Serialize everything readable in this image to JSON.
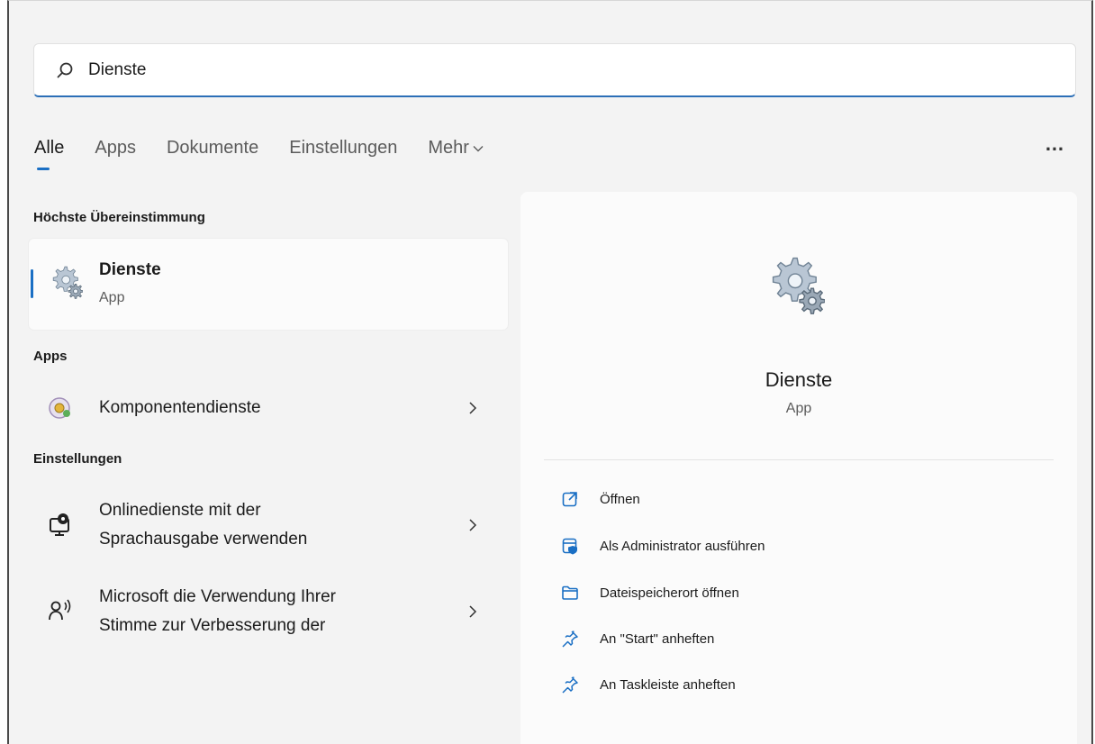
{
  "search": {
    "value": "Dienste"
  },
  "tabs": [
    {
      "label": "Alle"
    },
    {
      "label": "Apps"
    },
    {
      "label": "Dokumente"
    },
    {
      "label": "Einstellungen"
    },
    {
      "label": "Mehr"
    }
  ],
  "more_menu": "…",
  "sections": {
    "best_match": "Höchste Übereinstimmung",
    "apps": "Apps",
    "settings": "Einstellungen"
  },
  "best_match": {
    "title": "Dienste",
    "subtitle": "App",
    "icon": "services-gears-icon"
  },
  "apps": [
    {
      "label": "Komponentendienste",
      "icon": "component-services-icon"
    }
  ],
  "settings": [
    {
      "line1": "Onlinedienste mit der",
      "line2": "Sprachausgabe verwenden",
      "icon": "narrator-online-services-icon"
    },
    {
      "line1": "Microsoft die Verwendung Ihrer",
      "line2": "Stimme zur Verbesserung der",
      "icon": "voice-speech-icon"
    }
  ],
  "preview": {
    "title": "Dienste",
    "subtitle": "App",
    "actions": [
      {
        "label": "Öffnen",
        "icon": "open-external-icon"
      },
      {
        "label": "Als Administrator ausführen",
        "icon": "run-as-admin-icon"
      },
      {
        "label": "Dateispeicherort öffnen",
        "icon": "folder-icon"
      },
      {
        "label": "An \"Start\" anheften",
        "icon": "pin-icon"
      },
      {
        "label": "An Taskleiste anheften",
        "icon": "pin-icon"
      }
    ]
  },
  "colors": {
    "accent": "#1a6fc4",
    "background": "#f3f3f3",
    "card": "#fbfbfb"
  }
}
